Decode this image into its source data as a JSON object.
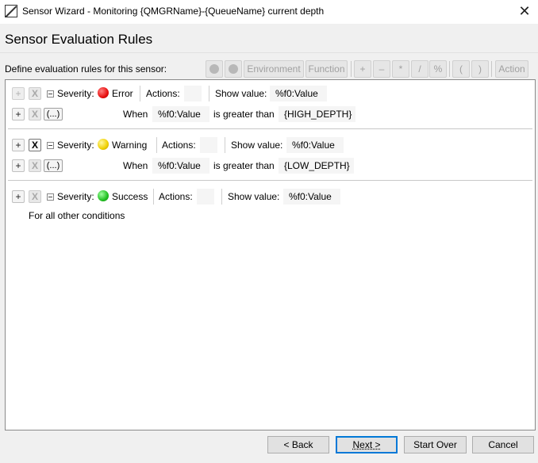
{
  "window": {
    "title": "Sensor Wizard - Monitoring {QMGRName}-{QueueName} current depth",
    "close": "✕"
  },
  "page": {
    "title": "Sensor Evaluation Rules",
    "define_label": "Define evaluation rules for this sensor:"
  },
  "toolbar": {
    "environment": "Environment",
    "function": "Function",
    "plus": "+",
    "minus": "–",
    "multiply": "*",
    "divide": "/",
    "percent": "%",
    "lparen": "(",
    "rparen": ")",
    "action": "Action"
  },
  "rules": [
    {
      "severity_label": "Severity:",
      "severity": "Error",
      "severity_color": "#e81010",
      "actions_label": "Actions:",
      "actions_value": "",
      "show_value_label": "Show value:",
      "show_value": "%f0:Value",
      "when_label": "When",
      "when_value": "%f0:Value",
      "operator": "is greater than",
      "threshold": "{HIGH_DEPTH}",
      "paren_label": "(...)"
    },
    {
      "severity_label": "Severity:",
      "severity": "Warning",
      "severity_color": "#f0d000",
      "actions_label": "Actions:",
      "actions_value": "",
      "show_value_label": "Show value:",
      "show_value": "%f0:Value",
      "when_label": "When",
      "when_value": "%f0:Value",
      "operator": "is greater than",
      "threshold": "{LOW_DEPTH}",
      "paren_label": "(...)"
    },
    {
      "severity_label": "Severity:",
      "severity": "Success",
      "severity_color": "#22c022",
      "actions_label": "Actions:",
      "actions_value": "",
      "show_value_label": "Show value:",
      "show_value": "%f0:Value",
      "otherwise_label": "For all other conditions"
    }
  ],
  "buttons": {
    "plus": "+",
    "delete": "X",
    "back": "< Back",
    "next": "Next >",
    "start_over": "Start Over",
    "cancel": "Cancel"
  }
}
